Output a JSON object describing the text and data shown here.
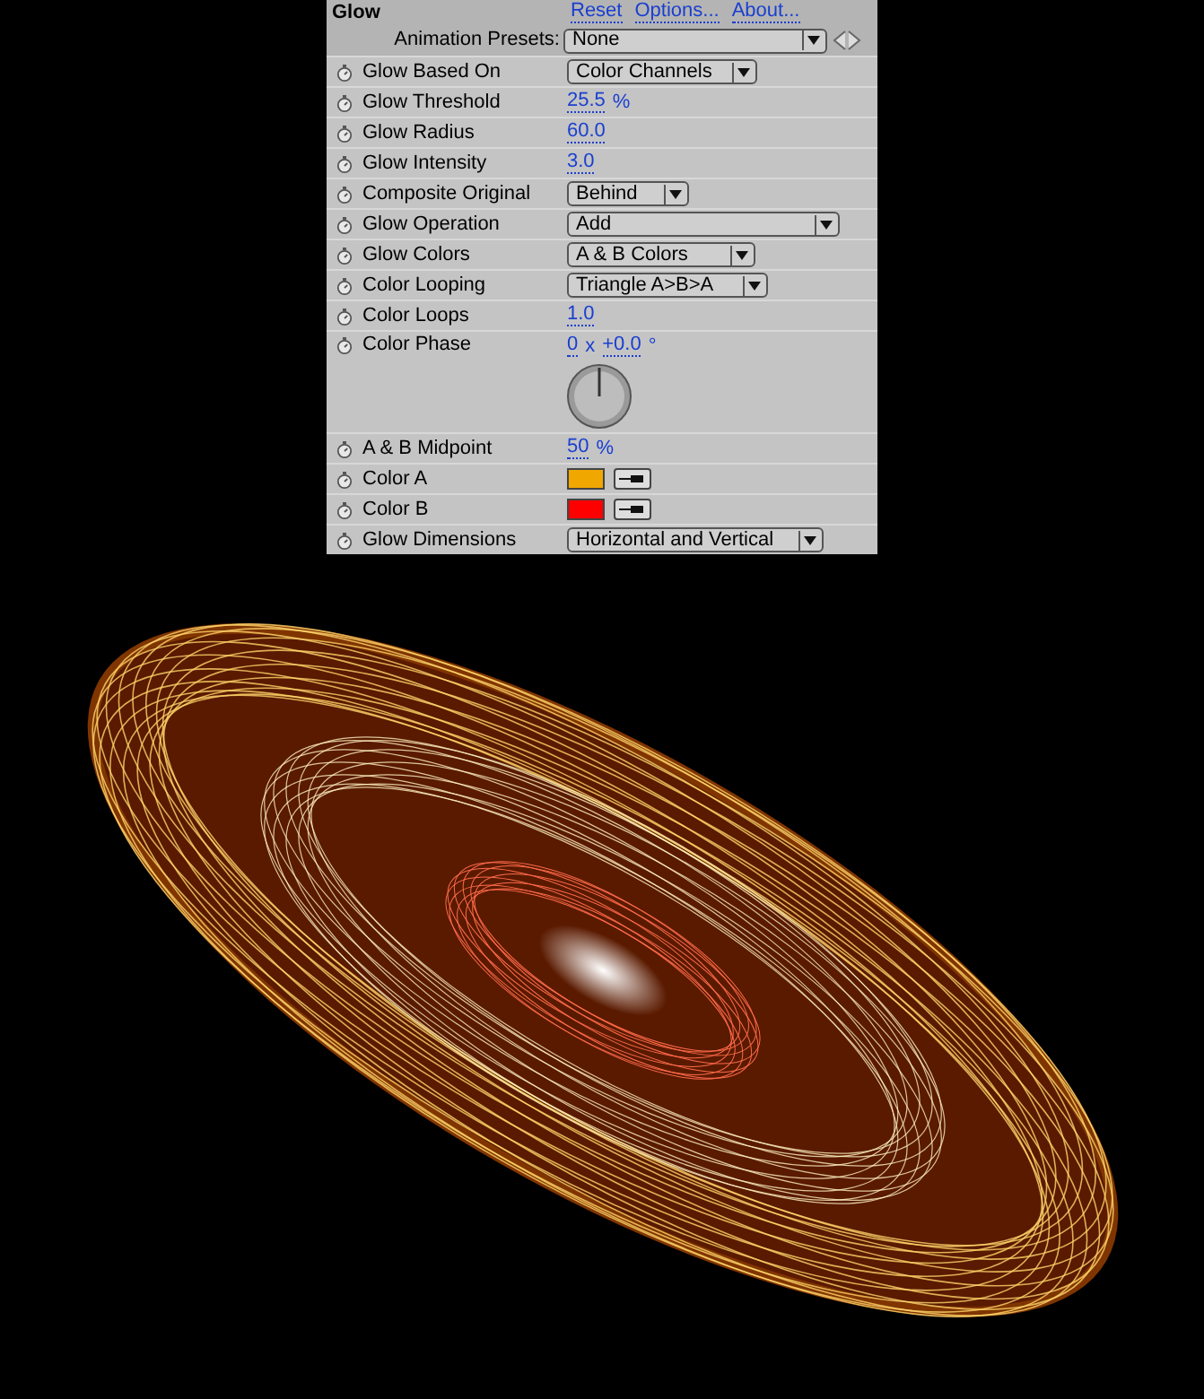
{
  "panel": {
    "title": "Glow",
    "links": [
      "Reset",
      "Options...",
      "About..."
    ],
    "presets": {
      "label": "Animation Presets:",
      "value": "None"
    },
    "rows": [
      {
        "kind": "dropdown",
        "label": "Glow Based On",
        "value": "Color Channels"
      },
      {
        "kind": "value",
        "label": "Glow Threshold",
        "parts": [
          {
            "text": "25.5",
            "link": true
          },
          {
            "text": "%",
            "link": false
          }
        ]
      },
      {
        "kind": "value",
        "label": "Glow Radius",
        "parts": [
          {
            "text": "60.0",
            "link": true
          }
        ]
      },
      {
        "kind": "value",
        "label": "Glow Intensity",
        "parts": [
          {
            "text": "3.0",
            "link": true
          }
        ]
      },
      {
        "kind": "dropdown",
        "label": "Composite Original",
        "value": "Behind"
      },
      {
        "kind": "dropdown",
        "label": "Glow Operation",
        "value": "Add"
      },
      {
        "kind": "dropdown",
        "label": "Glow Colors",
        "value": "A & B Colors"
      },
      {
        "kind": "dropdown",
        "label": "Color Looping",
        "value": "Triangle A>B>A"
      },
      {
        "kind": "value",
        "label": "Color Loops",
        "parts": [
          {
            "text": "1.0",
            "link": true
          }
        ]
      },
      {
        "kind": "dial",
        "label": "Color Phase",
        "parts": [
          {
            "text": "0",
            "link": true
          },
          {
            "text": "x",
            "link": false
          },
          {
            "text": "+0.0",
            "link": true
          },
          {
            "text": "°",
            "link": false
          }
        ]
      },
      {
        "kind": "value",
        "label": "A & B Midpoint",
        "parts": [
          {
            "text": "50",
            "link": true
          },
          {
            "text": "%",
            "link": false
          }
        ]
      },
      {
        "kind": "color",
        "label": "Color A",
        "color": "#f0a800"
      },
      {
        "kind": "color",
        "label": "Color B",
        "color": "#ff0000"
      },
      {
        "kind": "dropdown",
        "label": "Glow Dimensions",
        "value": "Horizontal and Vertical"
      }
    ]
  }
}
